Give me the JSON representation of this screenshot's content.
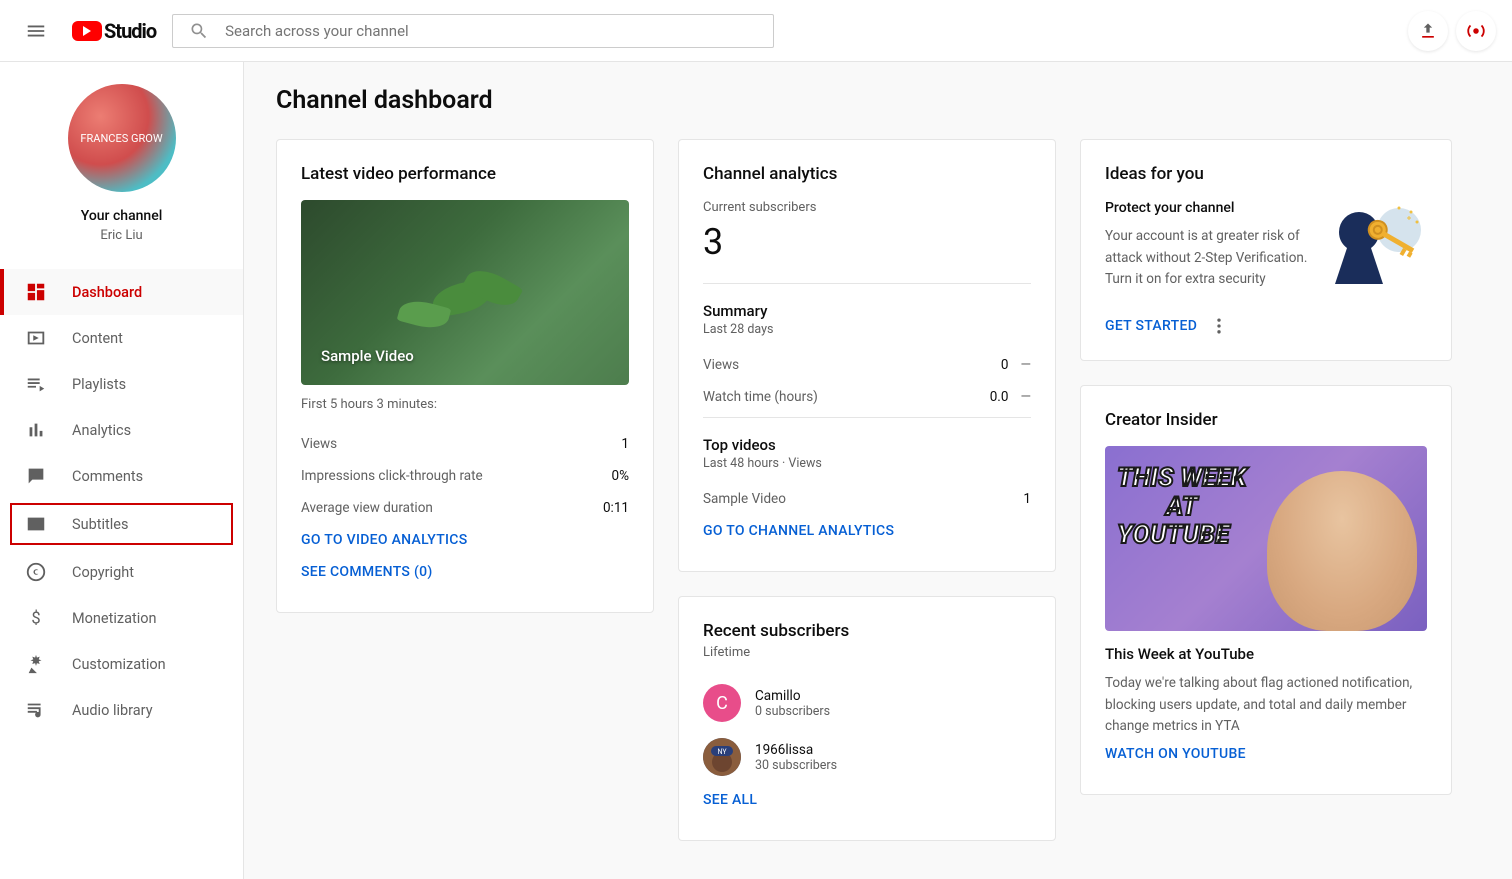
{
  "header": {
    "logo_text": "Studio",
    "search_placeholder": "Search across your channel"
  },
  "sidebar": {
    "channel_label": "Your channel",
    "channel_name": "Eric Liu",
    "avatar_text": "FRANCES GROW",
    "items": [
      {
        "label": "Dashboard",
        "icon": "dashboard"
      },
      {
        "label": "Content",
        "icon": "content"
      },
      {
        "label": "Playlists",
        "icon": "playlists"
      },
      {
        "label": "Analytics",
        "icon": "analytics"
      },
      {
        "label": "Comments",
        "icon": "comments"
      },
      {
        "label": "Subtitles",
        "icon": "subtitles"
      },
      {
        "label": "Copyright",
        "icon": "copyright"
      },
      {
        "label": "Monetization",
        "icon": "monetization"
      },
      {
        "label": "Customization",
        "icon": "customization"
      },
      {
        "label": "Audio library",
        "icon": "audio"
      }
    ]
  },
  "page_title": "Channel dashboard",
  "latest": {
    "title": "Latest video performance",
    "video_title": "Sample Video",
    "subline": "First 5 hours 3 minutes:",
    "stats": [
      {
        "label": "Views",
        "value": "1"
      },
      {
        "label": "Impressions click-through rate",
        "value": "0%"
      },
      {
        "label": "Average view duration",
        "value": "0:11"
      }
    ],
    "link_analytics": "GO TO VIDEO ANALYTICS",
    "link_comments": "SEE COMMENTS (0)"
  },
  "analytics": {
    "title": "Channel analytics",
    "sub_label": "Current subscribers",
    "sub_count": "3",
    "summary_title": "Summary",
    "summary_sub": "Last 28 days",
    "summary_stats": [
      {
        "label": "Views",
        "value": "0",
        "delta": "—"
      },
      {
        "label": "Watch time (hours)",
        "value": "0.0",
        "delta": "—"
      }
    ],
    "top_title": "Top videos",
    "top_sub": "Last 48 hours · Views",
    "top_videos": [
      {
        "label": "Sample Video",
        "value": "1"
      }
    ],
    "link": "GO TO CHANNEL ANALYTICS"
  },
  "recent": {
    "title": "Recent subscribers",
    "sub": "Lifetime",
    "items": [
      {
        "name": "Camillo",
        "count": "0 subscribers",
        "avatar_letter": "C",
        "avatar_bg": "#e84d8a"
      },
      {
        "name": "1966lissa",
        "count": "30 subscribers",
        "avatar_letter": "",
        "avatar_bg": "#8a5d3d"
      }
    ],
    "link": "SEE ALL"
  },
  "ideas": {
    "title": "Ideas for you",
    "subtitle": "Protect your channel",
    "body": "Your account is at greater risk of attack without 2-Step Verification. Turn it on for extra security",
    "link": "GET STARTED"
  },
  "creator": {
    "title": "Creator Insider",
    "thumb_text_1": "THIS WEEK",
    "thumb_text_2": "AT",
    "thumb_text_3": "YOUTUBE",
    "article_title": "This Week at YouTube",
    "body": "Today we're talking about flag actioned notification, blocking users update, and total and daily member change metrics in YTA",
    "link": "WATCH ON YOUTUBE"
  }
}
